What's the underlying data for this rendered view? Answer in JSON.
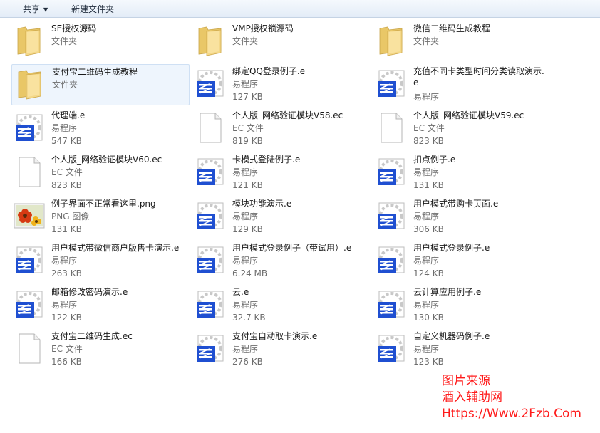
{
  "toolbar": {
    "share": "共享",
    "new_folder": "新建文件夹"
  },
  "items": [
    {
      "name": "SE授权源码",
      "type": "文件夹",
      "size": "",
      "icon": "folder"
    },
    {
      "name": "VMP授权锁源码",
      "type": "文件夹",
      "size": "",
      "icon": "folder"
    },
    {
      "name": "微信二维码生成教程",
      "type": "文件夹",
      "size": "",
      "icon": "folder"
    },
    {
      "name": "支付宝二维码生成教程",
      "type": "文件夹",
      "size": "",
      "icon": "folder",
      "selected": true
    },
    {
      "name": "绑定QQ登录例子.e",
      "type": "易程序",
      "size": "127 KB",
      "icon": "e"
    },
    {
      "name": "充值不同卡类型时间分类读取演示.e",
      "type": "易程序",
      "size": "",
      "icon": "e",
      "wrap": true
    },
    {
      "name": "代理端.e",
      "type": "易程序",
      "size": "547 KB",
      "icon": "e"
    },
    {
      "name": "个人版_网络验证模块V58.ec",
      "type": "EC 文件",
      "size": "819 KB",
      "icon": "doc"
    },
    {
      "name": "个人版_网络验证模块V59.ec",
      "type": "EC 文件",
      "size": "823 KB",
      "icon": "doc"
    },
    {
      "name": "个人版_网络验证模块V60.ec",
      "type": "EC 文件",
      "size": "823 KB",
      "icon": "doc"
    },
    {
      "name": "卡模式登陆例子.e",
      "type": "易程序",
      "size": "121 KB",
      "icon": "e"
    },
    {
      "name": "扣点例子.e",
      "type": "易程序",
      "size": "131 KB",
      "icon": "e"
    },
    {
      "name": "例子界面不正常看这里.png",
      "type": "PNG 图像",
      "size": "131 KB",
      "icon": "png"
    },
    {
      "name": "模块功能演示.e",
      "type": "易程序",
      "size": "129 KB",
      "icon": "e"
    },
    {
      "name": "用户模式带购卡页面.e",
      "type": "易程序",
      "size": "306 KB",
      "icon": "e"
    },
    {
      "name": "用户模式带微信商户版售卡演示.e",
      "type": "易程序",
      "size": "263 KB",
      "icon": "e"
    },
    {
      "name": "用户模式登录例子（带试用）.e",
      "type": "易程序",
      "size": "6.24 MB",
      "icon": "e"
    },
    {
      "name": "用户模式登录例子.e",
      "type": "易程序",
      "size": "124 KB",
      "icon": "e"
    },
    {
      "name": "邮箱修改密码演示.e",
      "type": "易程序",
      "size": "122 KB",
      "icon": "e"
    },
    {
      "name": "云.e",
      "type": "易程序",
      "size": "32.7 KB",
      "icon": "e"
    },
    {
      "name": "云计算应用例子.e",
      "type": "易程序",
      "size": "130 KB",
      "icon": "e"
    },
    {
      "name": "支付宝二维码生成.ec",
      "type": "EC 文件",
      "size": "166 KB",
      "icon": "doc"
    },
    {
      "name": "支付宝自动取卡演示.e",
      "type": "易程序",
      "size": "276 KB",
      "icon": "e"
    },
    {
      "name": "自定义机器码例子.e",
      "type": "易程序",
      "size": "123 KB",
      "icon": "e"
    }
  ],
  "watermark": {
    "line1": "图片来源",
    "line2": "酒入辅助网",
    "line3": "Https://Www.2Fzb.Com"
  },
  "colors": {
    "toolbar_bg": "#e3ecf7",
    "selection": "#eef5fd",
    "meta_text": "#6d6d6d",
    "watermark": "#ff1a1a",
    "e_icon_blue": "#1f4fd1"
  }
}
